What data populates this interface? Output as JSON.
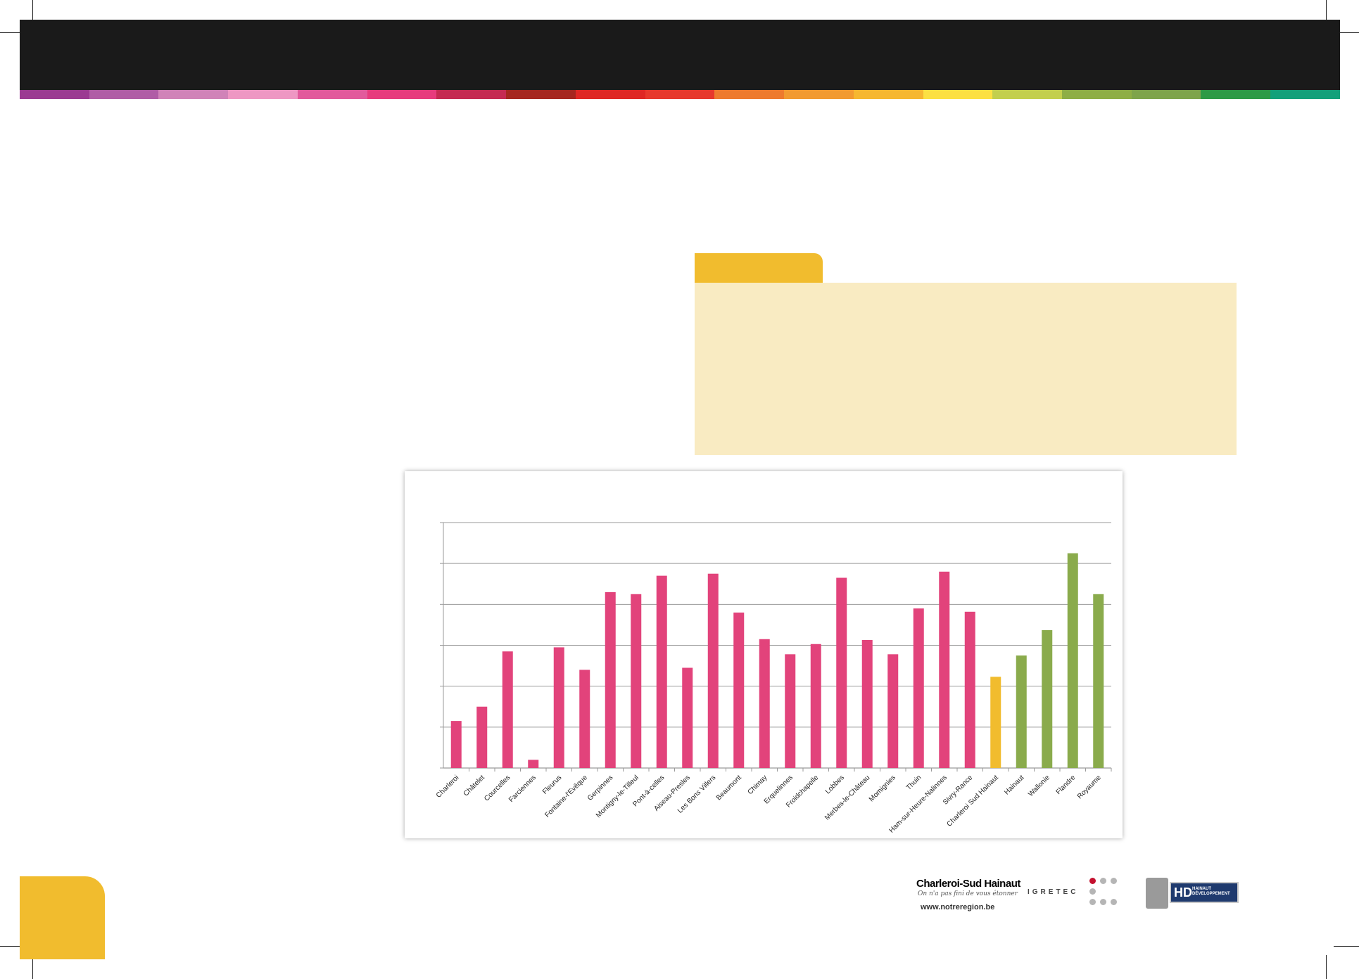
{
  "colors": {
    "header": "#1a1a1a",
    "strip": [
      "#9b3a92",
      "#b05da6",
      "#d083b8",
      "#ee97c3",
      "#e25a9c",
      "#e73b7d",
      "#c52a52",
      "#a6261f",
      "#df2724",
      "#e7382c",
      "#ee7a2e",
      "#f29a31",
      "#f6b731",
      "#fce042",
      "#c3cf4d",
      "#8eae45",
      "#7ea44b",
      "#2d9a46",
      "#13a07a"
    ],
    "folder_tab": "#f1bc2e",
    "folder_body": "#f9ebc2",
    "commune_bar": "#e2437b",
    "region_bar": "#f1bc2e",
    "reference_bar": "#8aab4c"
  },
  "chart_data": {
    "type": "bar",
    "categories": [
      "Charleroi",
      "Châtelet",
      "Courcelles",
      "Farciennes",
      "Fleurus",
      "Fontaine-l'Evêque",
      "Gerpinnes",
      "Montigny-le-Tilleul",
      "Pont-à-celles",
      "Aiseau-Presles",
      "Les Bons Villers",
      "Beaumont",
      "Chimay",
      "Erquelinnes",
      "Froidchapelle",
      "Lobbes",
      "Merbes-le-Château",
      "Momignies",
      "Thuin",
      "Ham-sur-Heure-Nalinnes",
      "Sivry-Rance",
      "Charleroi Sud Hainaut",
      "Hainaut",
      "Wallonie",
      "Flandre",
      "Royaume"
    ],
    "values": [
      1.15,
      1.5,
      2.85,
      0.2,
      2.95,
      2.4,
      4.3,
      4.25,
      4.7,
      2.45,
      4.75,
      3.8,
      3.15,
      2.78,
      3.03,
      4.65,
      3.13,
      2.78,
      3.9,
      4.8,
      3.82,
      2.23,
      2.75,
      3.37,
      5.25,
      4.25
    ],
    "bar_groups": [
      "commune",
      "commune",
      "commune",
      "commune",
      "commune",
      "commune",
      "commune",
      "commune",
      "commune",
      "commune",
      "commune",
      "commune",
      "commune",
      "commune",
      "commune",
      "commune",
      "commune",
      "commune",
      "commune",
      "commune",
      "commune",
      "region",
      "reference",
      "reference",
      "reference",
      "reference"
    ],
    "ylim": [
      0,
      6
    ],
    "yticks": [
      0,
      1,
      2,
      3,
      4,
      5,
      6
    ],
    "grid": true,
    "legend": "none",
    "title": "",
    "xlabel": "",
    "ylabel": ""
  },
  "logos": {
    "csh_name": "Charleroi-Sud Hainaut",
    "csh_tagline": "On n'a pas fini de vous étonner",
    "url": "www.notreregion.be",
    "igretec": "IGRETEC",
    "hd_letters": "HD",
    "hd_line1": "HAINAUT",
    "hd_line2": "DÉVELOPPEMENT"
  }
}
